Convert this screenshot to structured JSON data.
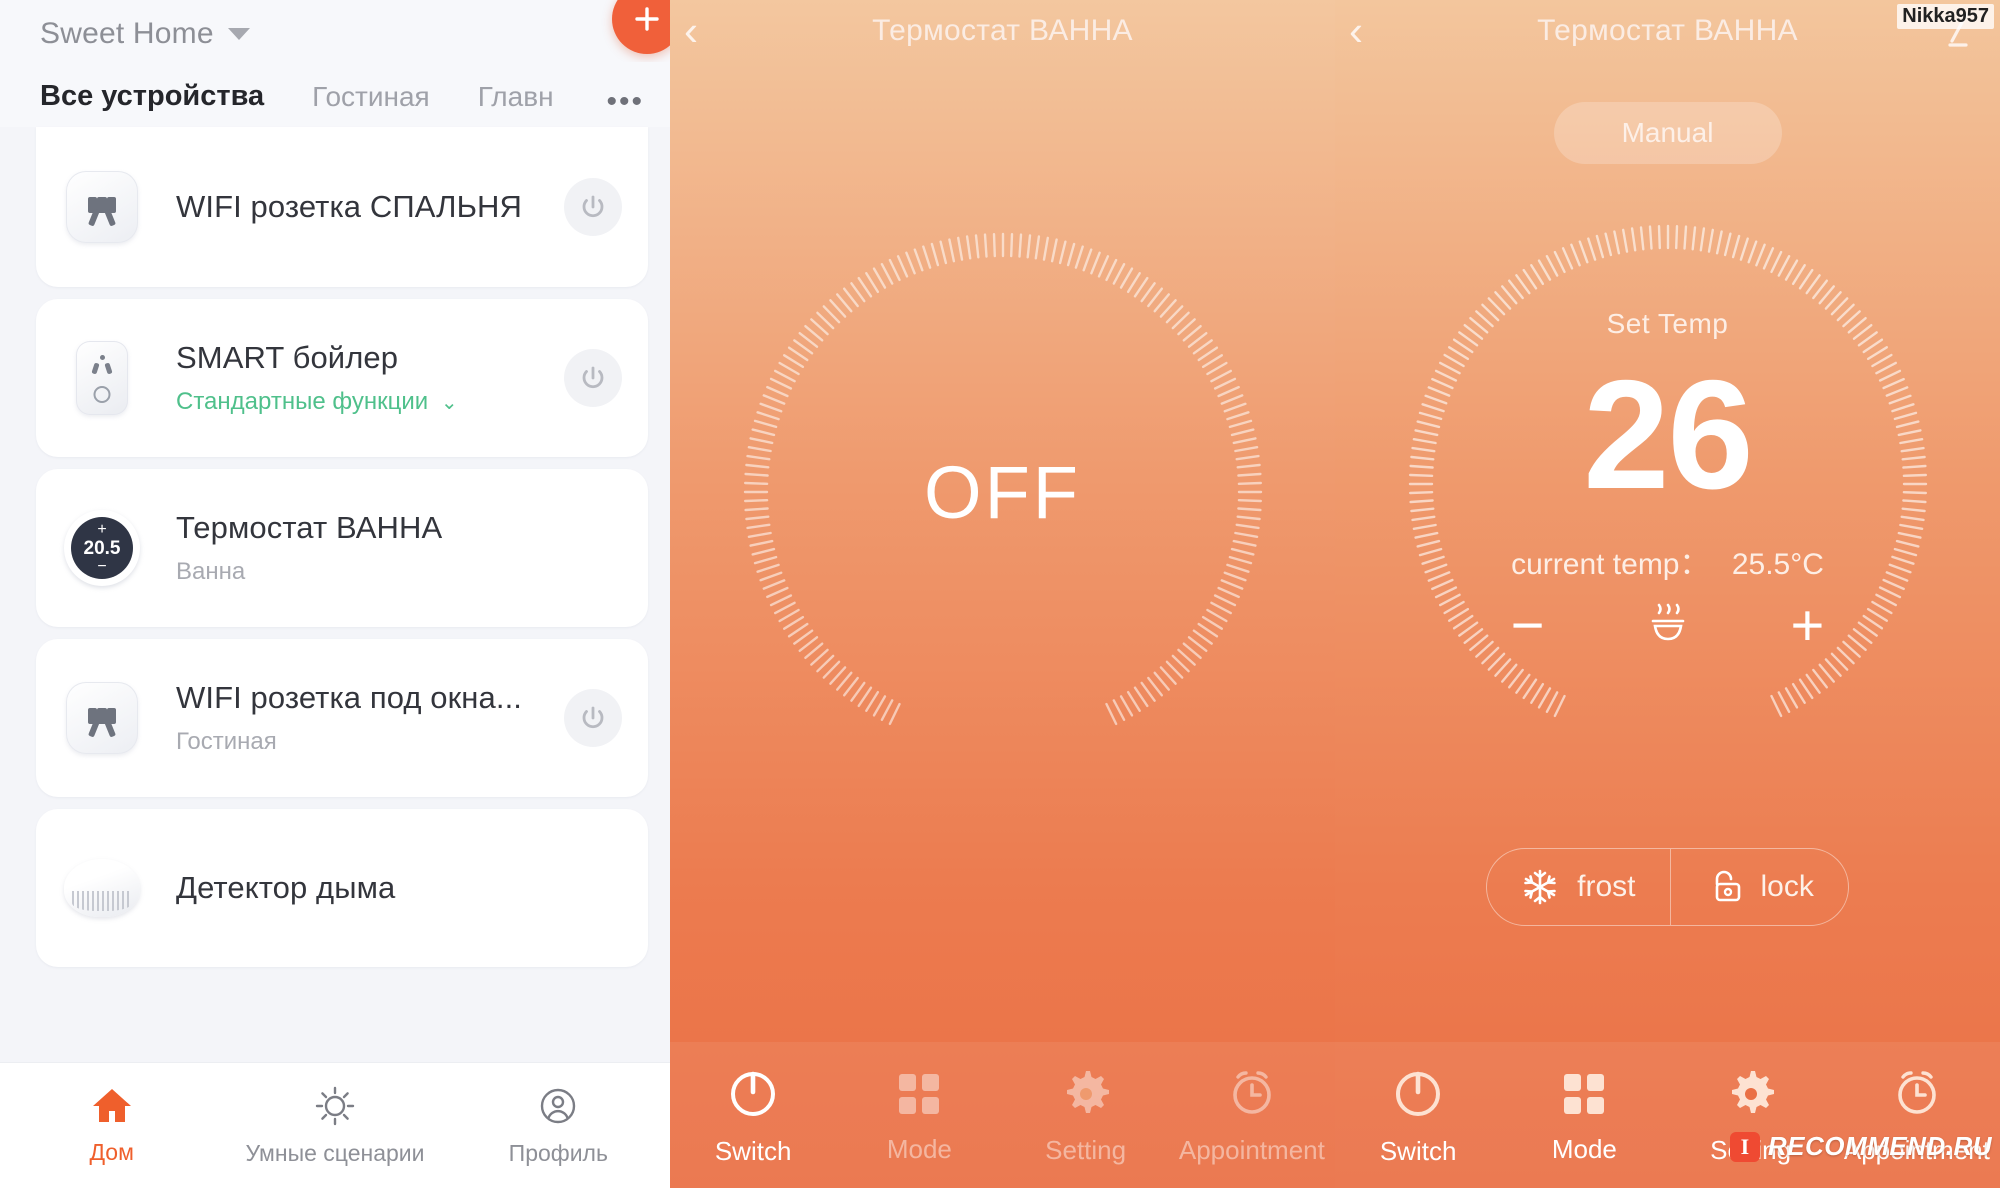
{
  "home": {
    "name": "Sweet Home",
    "add_button": "+",
    "tabs": [
      {
        "label": "Все устройства",
        "active": true
      },
      {
        "label": "Гостиная",
        "active": false
      },
      {
        "label": "Главн",
        "active": false
      }
    ],
    "tabs_more": "•••",
    "devices": [
      {
        "title": "WIFI розетка СПАЛЬНЯ",
        "subtitle": "",
        "subtitle_style": "none",
        "icon": "socket-icon",
        "has_power": true
      },
      {
        "title": "SMART бойлер",
        "subtitle": "Стандартные функции",
        "subtitle_style": "green",
        "icon": "smart-plug-icon",
        "has_power": true
      },
      {
        "title": "Термостат ВАННА",
        "subtitle": "Ванна",
        "subtitle_style": "grey",
        "icon": "thermostat-dial-icon",
        "icon_value": "20.5",
        "has_power": false
      },
      {
        "title": "WIFI розетка под окна...",
        "subtitle": "Гостиная",
        "subtitle_style": "grey",
        "icon": "socket-icon",
        "has_power": true
      },
      {
        "title": "Детектор дыма",
        "subtitle": "",
        "subtitle_style": "none",
        "icon": "smoke-detector-icon",
        "has_power": false
      }
    ],
    "nav": [
      {
        "label": "Дом",
        "icon": "home-icon",
        "active": true
      },
      {
        "label": "Умные сценарии",
        "icon": "sun-icon",
        "active": false
      },
      {
        "label": "Профиль",
        "icon": "user-circle-icon",
        "active": false
      }
    ]
  },
  "thermostat_off": {
    "title": "Термостат ВАННА",
    "back": "‹",
    "edit_icon": "pencil-icon",
    "state": "OFF",
    "tabs": [
      {
        "label": "Switch",
        "icon": "power-icon",
        "active": true
      },
      {
        "label": "Mode",
        "icon": "grid-icon",
        "active": false
      },
      {
        "label": "Setting",
        "icon": "gear-icon",
        "active": false
      },
      {
        "label": "Appointment",
        "icon": "alarm-clock-icon",
        "active": false
      }
    ]
  },
  "thermostat_on": {
    "title": "Термостат ВАННА",
    "back": "‹",
    "edit_icon": "pencil-icon",
    "mode_pill": "Manual",
    "set_temp_label": "Set Temp",
    "set_temp_value": "26",
    "current_temp_label": "current temp：",
    "current_temp_value": "25.5°C",
    "minus": "−",
    "plus": "+",
    "heat_icon": "heating-steam-icon",
    "mini_actions": [
      {
        "label": "frost",
        "icon": "snowflake-icon"
      },
      {
        "label": "lock",
        "icon": "unlocked-padlock-icon"
      }
    ],
    "tabs": [
      {
        "label": "Switch",
        "icon": "power-icon",
        "active": true
      },
      {
        "label": "Mode",
        "icon": "grid-icon",
        "active": true
      },
      {
        "label": "Setting",
        "icon": "gear-icon",
        "active": true
      },
      {
        "label": "Appointment",
        "icon": "alarm-clock-icon",
        "active": true
      }
    ]
  },
  "watermarks": {
    "user": "Nikka957",
    "brand_badge": "I",
    "brand": "RECOMMEND.RU"
  },
  "colors": {
    "accent": "#ef5f2c",
    "panel_top": "#f3c79f",
    "panel_bottom": "#ea6f44",
    "green": "#4fc08b"
  }
}
